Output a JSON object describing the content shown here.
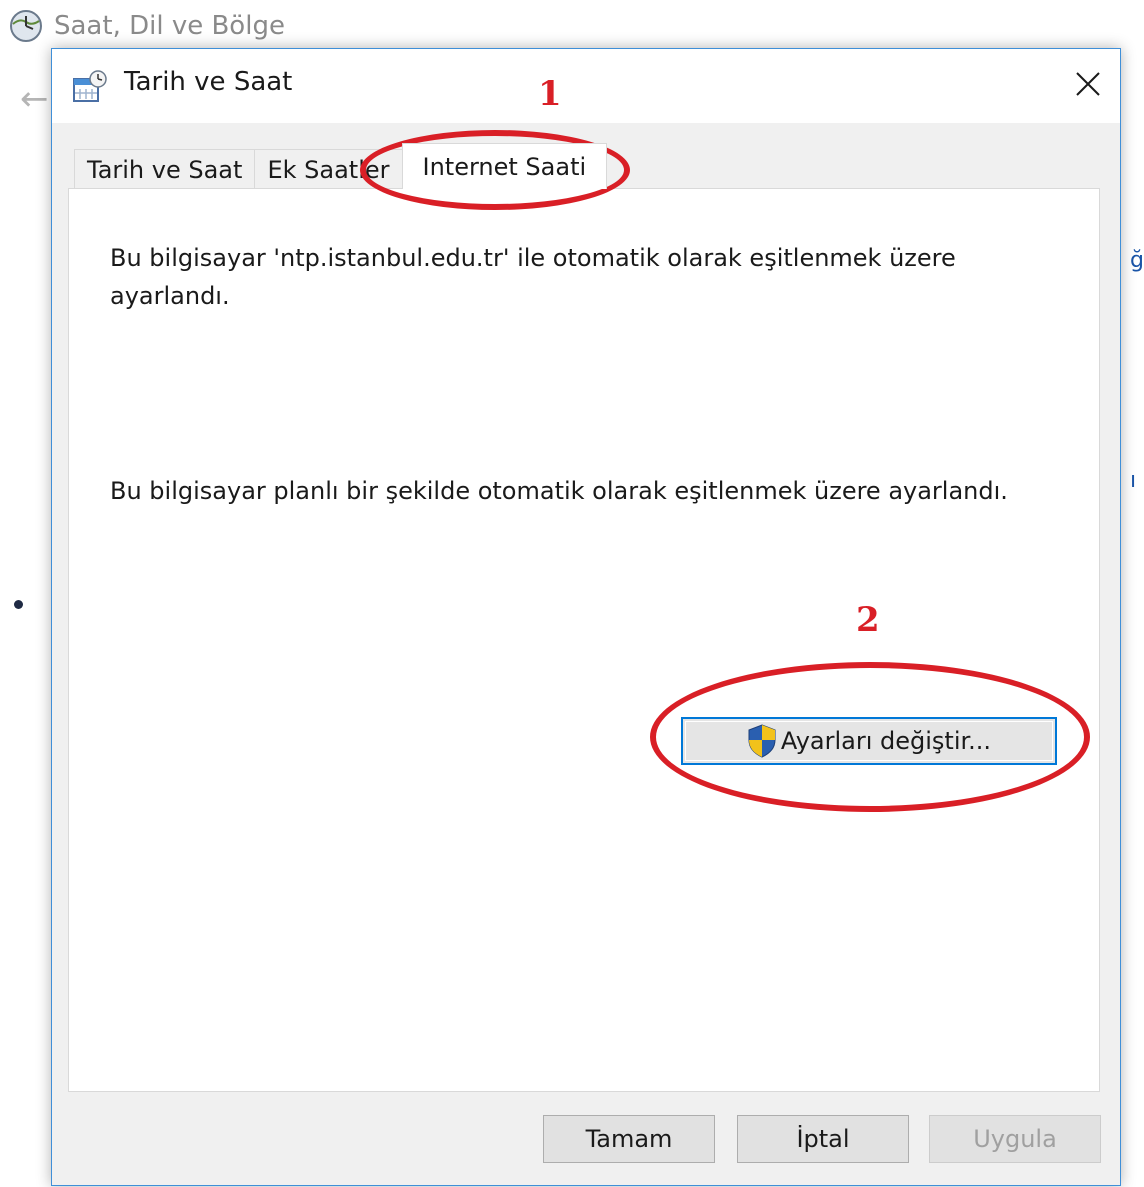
{
  "background_window": {
    "title": "Saat, Dil ve Bölge",
    "edge_text_1": "ği",
    "edge_text_2": "ı l"
  },
  "dialog": {
    "title": "Tarih ve Saat",
    "tabs": [
      {
        "label": "Tarih ve Saat",
        "active": false
      },
      {
        "label": "Ek Saatler",
        "active": false
      },
      {
        "label": "Internet Saati",
        "active": true
      }
    ],
    "message_server": "Bu bilgisayar 'ntp.istanbul.edu.tr' ile otomatik olarak eşitlenmek üzere ayarlandı.",
    "message_schedule": "Bu bilgisayar planlı bir şekilde otomatik olarak eşitlenmek üzere ayarlandı.",
    "change_settings_label": "Ayarları değiştir...",
    "buttons": {
      "ok": "Tamam",
      "cancel": "İptal",
      "apply": "Uygula",
      "apply_enabled": false
    }
  },
  "annotations": {
    "step1": "1",
    "step2": "2",
    "color": "#d91f26"
  },
  "icons": {
    "background": "clock-globe-icon",
    "dialog": "calendar-clock-icon",
    "close": "close-icon",
    "uac": "uac-shield-icon"
  }
}
